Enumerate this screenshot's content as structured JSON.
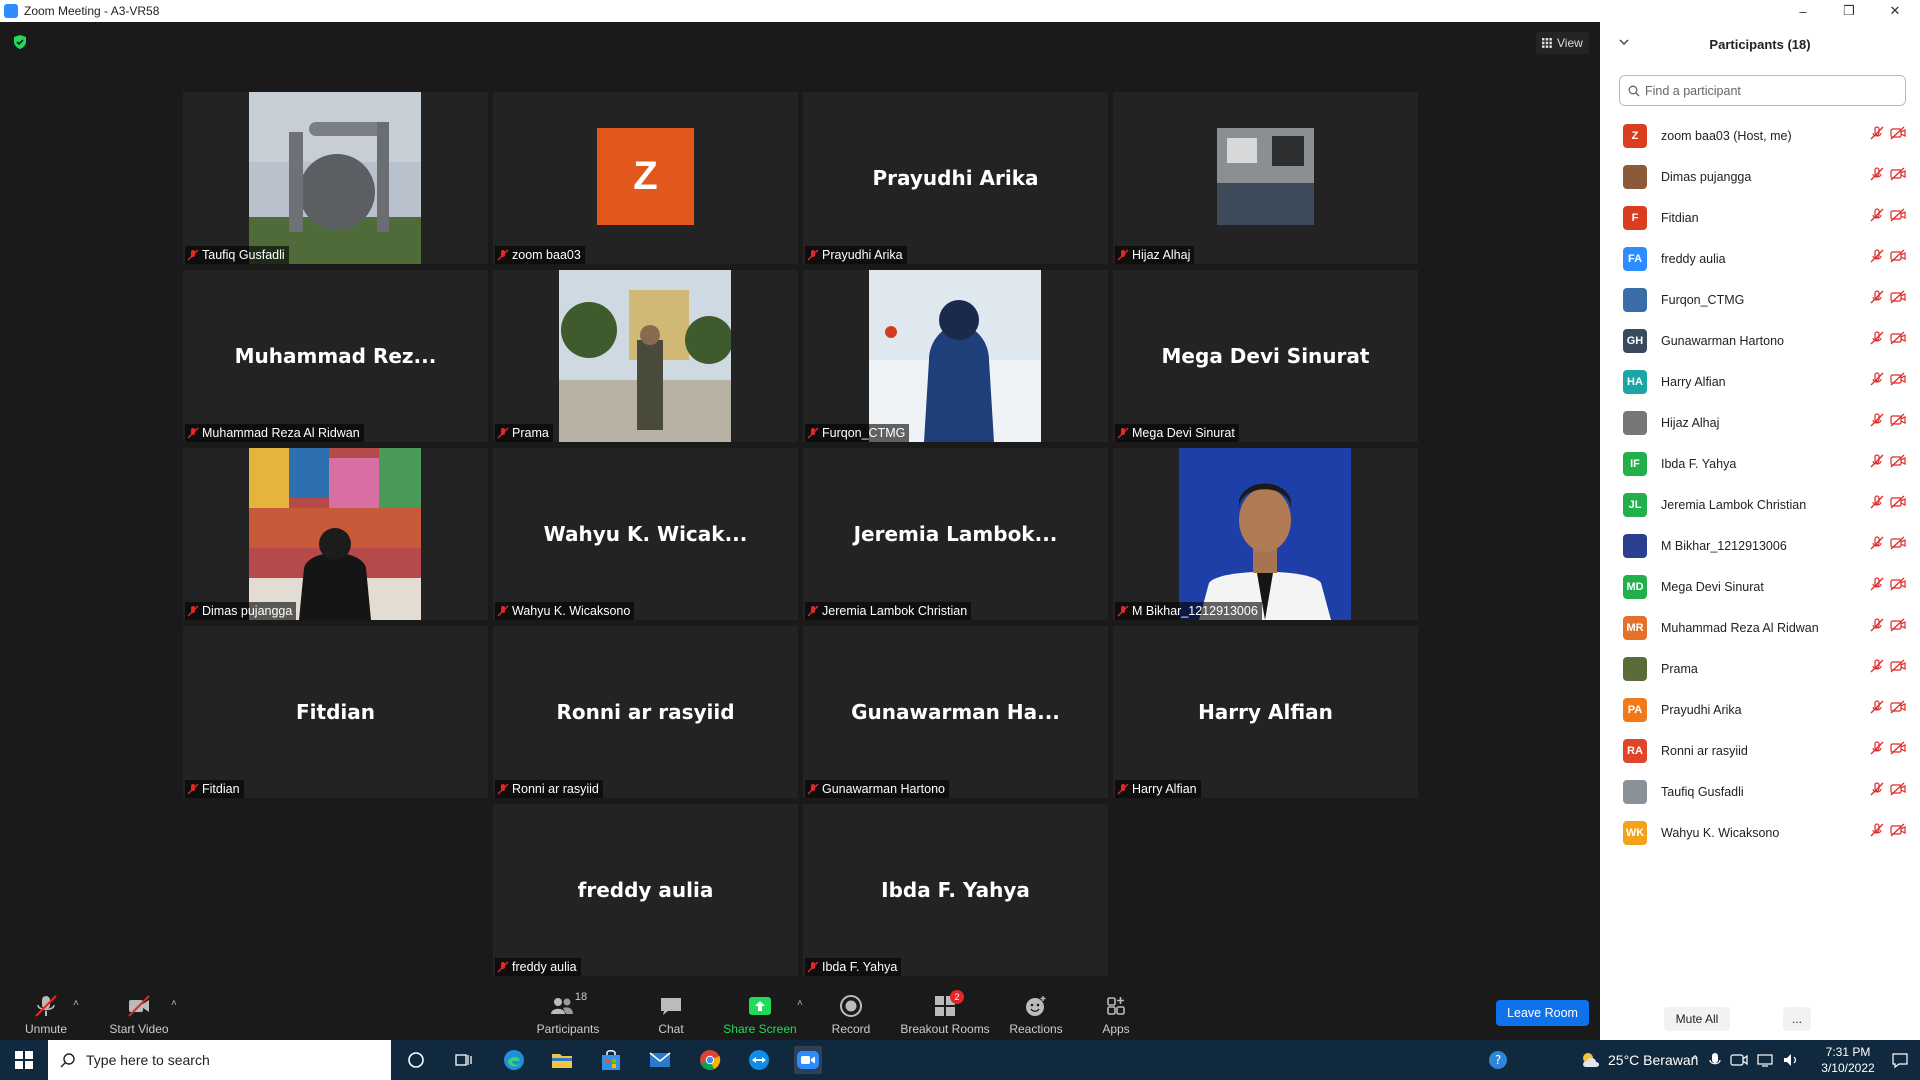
{
  "window": {
    "title": "Zoom Meeting - A3-VR58",
    "minimize": "–",
    "restore": "❒",
    "close": "✕"
  },
  "view": {
    "label": "View"
  },
  "tiles": [
    {
      "label": "Taufiq Gusfadli",
      "big": ""
    },
    {
      "label": "zoom baa03",
      "big": "",
      "initial": "Z"
    },
    {
      "label": "Prayudhi Arika",
      "big": "Prayudhi Arika"
    },
    {
      "label": "Hijaz Alhaj",
      "big": ""
    },
    {
      "label": "Muhammad Reza Al Ridwan",
      "big": "Muhammad  Rez..."
    },
    {
      "label": "Prama",
      "big": ""
    },
    {
      "label": "Furqon_CTMG",
      "big": ""
    },
    {
      "label": "Mega Devi Sinurat",
      "big": "Mega Devi Sinurat"
    },
    {
      "label": "Dimas pujangga",
      "big": ""
    },
    {
      "label": "Wahyu K. Wicaksono",
      "big": "Wahyu  K.  Wicak..."
    },
    {
      "label": "Jeremia Lambok Christian",
      "big": "Jeremia  Lambok..."
    },
    {
      "label": "M Bikhar_1212913006",
      "big": ""
    },
    {
      "label": "Fitdian",
      "big": "Fitdian"
    },
    {
      "label": "Ronni ar rasyiid",
      "big": "Ronni ar rasyiid"
    },
    {
      "label": "Gunawarman Hartono",
      "big": "Gunawarman  Ha..."
    },
    {
      "label": "Harry Alfian",
      "big": "Harry Alfian"
    },
    {
      "label": "freddy aulia",
      "big": "freddy aulia"
    },
    {
      "label": "Ibda F. Yahya",
      "big": "Ibda F. Yahya"
    }
  ],
  "toolbar": {
    "unmute": "Unmute",
    "start_video": "Start Video",
    "participants": "Participants",
    "participants_count": "18",
    "chat": "Chat",
    "share_screen": "Share Screen",
    "record": "Record",
    "breakout": "Breakout Rooms",
    "breakout_badge": "2",
    "reactions": "Reactions",
    "apps": "Apps",
    "leave": "Leave Room",
    "caret": "˄"
  },
  "panel": {
    "title": "Participants (18)",
    "search_placeholder": "Find a participant",
    "mute_all": "Mute All",
    "more": "...",
    "participants": [
      {
        "name": "zoom baa03 (Host, me)",
        "initials": "Z",
        "color": "#d93f1e"
      },
      {
        "name": "Dimas pujangga",
        "initials": "",
        "color": "#8a5a3a"
      },
      {
        "name": "Fitdian",
        "initials": "F",
        "color": "#d93f1e"
      },
      {
        "name": "freddy aulia",
        "initials": "FA",
        "color": "#2d8cff"
      },
      {
        "name": "Furqon_CTMG",
        "initials": "",
        "color": "#3b6ea8"
      },
      {
        "name": "Gunawarman Hartono",
        "initials": "GH",
        "color": "#3a4a5c"
      },
      {
        "name": "Harry Alfian",
        "initials": "HA",
        "color": "#1aa6a6"
      },
      {
        "name": "Hijaz Alhaj",
        "initials": "",
        "color": "#777777"
      },
      {
        "name": "Ibda F. Yahya",
        "initials": "IF",
        "color": "#22b04b"
      },
      {
        "name": "Jeremia Lambok Christian",
        "initials": "JL",
        "color": "#22b04b"
      },
      {
        "name": "M Bikhar_1212913006",
        "initials": "",
        "color": "#2a3f8f"
      },
      {
        "name": "Mega Devi Sinurat",
        "initials": "MD",
        "color": "#22b04b"
      },
      {
        "name": "Muhammad Reza Al Ridwan",
        "initials": "MR",
        "color": "#e5702a"
      },
      {
        "name": "Prama",
        "initials": "",
        "color": "#5c6b3a"
      },
      {
        "name": "Prayudhi Arika",
        "initials": "PA",
        "color": "#f07a1a"
      },
      {
        "name": "Ronni ar rasyiid",
        "initials": "RA",
        "color": "#e0442a"
      },
      {
        "name": "Taufiq Gusfadli",
        "initials": "",
        "color": "#8a9199"
      },
      {
        "name": "Wahyu K. Wicaksono",
        "initials": "WK",
        "color": "#f2a31b"
      }
    ]
  },
  "taskbar": {
    "search_placeholder": "Type here to search",
    "weather": "25°C  Berawan",
    "time": "7:31 PM",
    "date": "3/10/2022"
  }
}
